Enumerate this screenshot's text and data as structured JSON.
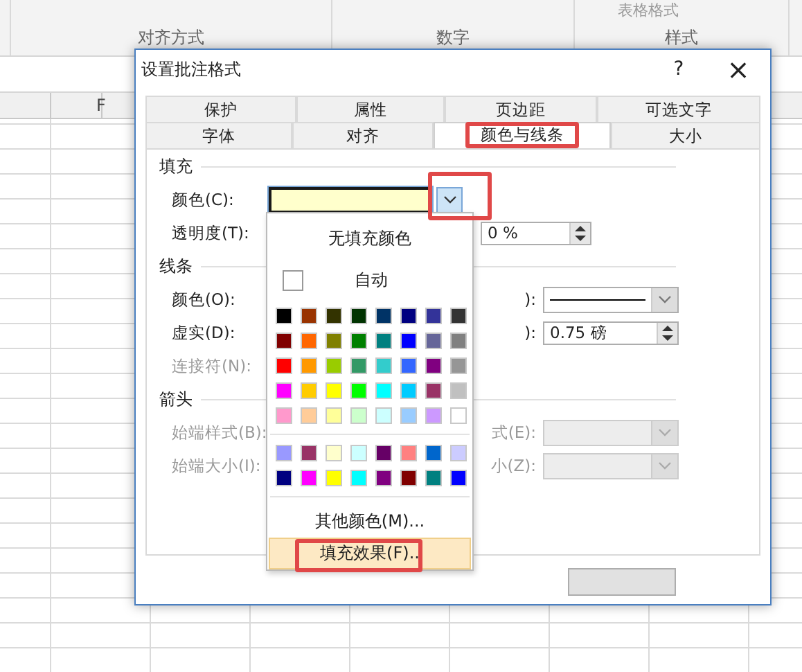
{
  "ribbon": {
    "overflow_label": "表格格式",
    "groups": [
      {
        "label": "对齐方式"
      },
      {
        "label": "数字"
      },
      {
        "label": "样式"
      }
    ]
  },
  "sheet": {
    "column_header": "F"
  },
  "dialog": {
    "title": "设置批注格式",
    "help": "?",
    "close": "×",
    "tab_rows": [
      {
        "tabs": [
          {
            "label": "保护",
            "selected": false
          },
          {
            "label": "属性",
            "selected": false
          },
          {
            "label": "页边距",
            "selected": false
          },
          {
            "label": "可选文字",
            "selected": false
          }
        ]
      },
      {
        "tabs": [
          {
            "label": "字体",
            "selected": false
          },
          {
            "label": "对齐",
            "selected": false
          },
          {
            "label": "颜色与线条",
            "selected": true,
            "highlighted": true
          },
          {
            "label": "大小",
            "selected": false
          }
        ]
      }
    ],
    "fill": {
      "heading": "填充",
      "color_label": "颜色(C):",
      "color": "#ffffcc",
      "dropdown_highlighted": true,
      "transparency_label": "透明度(T):",
      "transparency_value": "0 %"
    },
    "line": {
      "heading": "线条",
      "color_label": "颜色(O):",
      "style_label": "):",
      "dash_label": "虚实(D):",
      "weight_label": "):",
      "weight_value": "0.75 磅",
      "connector_label": "连接符(N):",
      "connector_disabled": true
    },
    "arrows": {
      "heading": "箭头",
      "disabled": true,
      "begin_style_label": "始端样式(B):",
      "end_style_label": "式(E):",
      "begin_size_label": "始端大小(I):",
      "end_size_label": "小(Z):"
    }
  },
  "popup": {
    "no_fill": "无填充颜色",
    "automatic": "自动",
    "standard_rows": [
      {
        "swatches": [
          {
            "color": "#000000"
          },
          {
            "color": "#993300"
          },
          {
            "color": "#333300"
          },
          {
            "color": "#003300"
          },
          {
            "color": "#003366"
          },
          {
            "color": "#000080"
          },
          {
            "color": "#333399"
          },
          {
            "color": "#333333"
          }
        ]
      },
      {
        "swatches": [
          {
            "color": "#800000"
          },
          {
            "color": "#ff6600"
          },
          {
            "color": "#808000"
          },
          {
            "color": "#008000"
          },
          {
            "color": "#008080"
          },
          {
            "color": "#0000ff"
          },
          {
            "color": "#666699"
          },
          {
            "color": "#808080"
          }
        ]
      },
      {
        "swatches": [
          {
            "color": "#ff0000"
          },
          {
            "color": "#ff9900"
          },
          {
            "color": "#99cc00"
          },
          {
            "color": "#339966"
          },
          {
            "color": "#33cccc"
          },
          {
            "color": "#3366ff"
          },
          {
            "color": "#800080"
          },
          {
            "color": "#969696"
          }
        ]
      },
      {
        "swatches": [
          {
            "color": "#ff00ff"
          },
          {
            "color": "#ffcc00"
          },
          {
            "color": "#ffff00"
          },
          {
            "color": "#00ff00"
          },
          {
            "color": "#00ffff"
          },
          {
            "color": "#00ccff"
          },
          {
            "color": "#993366"
          },
          {
            "color": "#c0c0c0"
          }
        ]
      },
      {
        "swatches": [
          {
            "color": "#ff99cc"
          },
          {
            "color": "#ffcc99"
          },
          {
            "color": "#ffff99"
          },
          {
            "color": "#ccffcc"
          },
          {
            "color": "#ccffff"
          },
          {
            "color": "#99ccff"
          },
          {
            "color": "#cc99ff"
          },
          {
            "color": "#ffffff"
          }
        ]
      }
    ],
    "extra_rows": [
      {
        "swatches": [
          {
            "color": "#9999ff"
          },
          {
            "color": "#993366"
          },
          {
            "color": "#ffffcc"
          },
          {
            "color": "#ccffff"
          },
          {
            "color": "#660066"
          },
          {
            "color": "#ff8080"
          },
          {
            "color": "#0066cc"
          },
          {
            "color": "#ccccff"
          }
        ]
      },
      {
        "swatches": [
          {
            "color": "#000080"
          },
          {
            "color": "#ff00ff"
          },
          {
            "color": "#ffff00"
          },
          {
            "color": "#00ffff"
          },
          {
            "color": "#800080"
          },
          {
            "color": "#800000"
          },
          {
            "color": "#008080"
          },
          {
            "color": "#0000ff"
          }
        ]
      }
    ],
    "more_colors": "其他颜色(M)...",
    "fill_effects": "填充效果(F)..",
    "fill_effects_hovered": true,
    "fill_effects_highlighted": true
  }
}
